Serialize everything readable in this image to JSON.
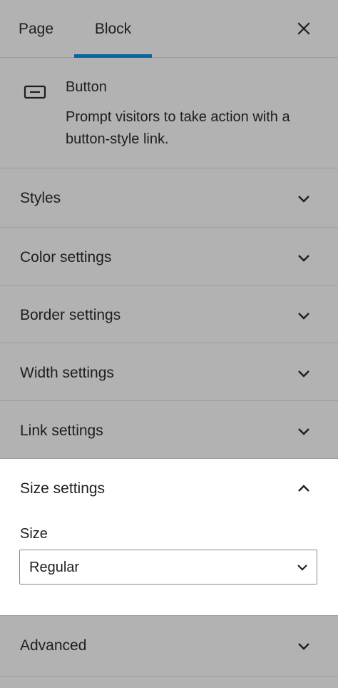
{
  "tabs": {
    "page_label": "Page",
    "block_label": "Block",
    "active": "Block"
  },
  "close_icon": "close-icon",
  "block_card": {
    "icon": "button-block-icon",
    "title": "Button",
    "description": "Prompt visitors to take action with a button-style link."
  },
  "panels": [
    {
      "label": "Styles",
      "expanded": false,
      "icon": "chevron-down-icon"
    },
    {
      "label": "Color settings",
      "expanded": false,
      "icon": "chevron-down-icon"
    },
    {
      "label": "Border settings",
      "expanded": false,
      "icon": "chevron-down-icon"
    },
    {
      "label": "Width settings",
      "expanded": false,
      "icon": "chevron-down-icon"
    },
    {
      "label": "Link settings",
      "expanded": false,
      "icon": "chevron-down-icon"
    },
    {
      "label": "Size settings",
      "expanded": true,
      "icon": "chevron-up-icon"
    },
    {
      "label": "Advanced",
      "expanded": false,
      "icon": "chevron-down-icon"
    }
  ],
  "size_settings": {
    "field_label": "Size",
    "selected": "Regular"
  },
  "colors": {
    "accent": "#0a6699",
    "overlay": "#b2b2b2",
    "active_panel_bg": "#ffffff"
  }
}
